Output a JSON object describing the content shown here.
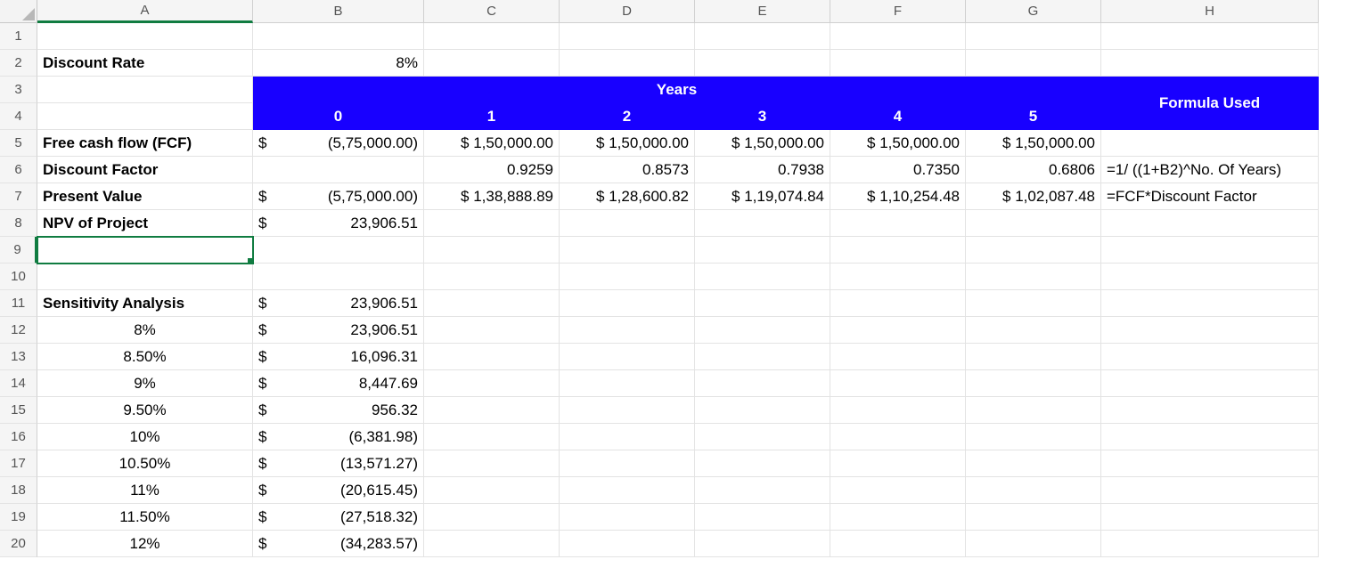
{
  "columns": [
    "A",
    "B",
    "C",
    "D",
    "E",
    "F",
    "G",
    "H"
  ],
  "row_numbers": [
    "1",
    "2",
    "3",
    "4",
    "5",
    "6",
    "7",
    "8",
    "9",
    "10",
    "11",
    "12",
    "13",
    "14",
    "15",
    "16",
    "17",
    "18",
    "19",
    "20"
  ],
  "active_col": "A",
  "active_row": "9",
  "labels": {
    "discount_rate": "Discount Rate",
    "years": "Years",
    "formula_used": "Formula Used",
    "fcf": "Free cash flow (FCF)",
    "discount_factor": "Discount Factor",
    "present_value": "Present Value",
    "npv": "NPV of Project",
    "sensitivity": "Sensitivity Analysis"
  },
  "discount_rate_value": "8%",
  "year_headers": [
    "0",
    "1",
    "2",
    "3",
    "4",
    "5"
  ],
  "fcf": {
    "y0": "(5,75,000.00)",
    "y1": "$ 1,50,000.00",
    "y2": "$ 1,50,000.00",
    "y3": "$ 1,50,000.00",
    "y4": "$ 1,50,000.00",
    "y5": "$ 1,50,000.00"
  },
  "discount_factor_vals": {
    "y1": "0.9259",
    "y2": "0.8573",
    "y3": "0.7938",
    "y4": "0.7350",
    "y5": "0.6806"
  },
  "pv": {
    "y0": "(5,75,000.00)",
    "y1": "$ 1,38,888.89",
    "y2": "$ 1,28,600.82",
    "y3": "$ 1,19,074.84",
    "y4": "$ 1,10,254.48",
    "y5": "$ 1,02,087.48"
  },
  "npv_value": "23,906.51",
  "formulas": {
    "df": "=1/ ((1+B2)^No. Of Years)",
    "pv": "=FCF*Discount Factor"
  },
  "sensitivity": {
    "header_val": "23,906.51",
    "rows": [
      {
        "rate": "8%",
        "val": "23,906.51"
      },
      {
        "rate": "8.50%",
        "val": "16,096.31"
      },
      {
        "rate": "9%",
        "val": "8,447.69"
      },
      {
        "rate": "9.50%",
        "val": "956.32"
      },
      {
        "rate": "10%",
        "val": "(6,381.98)"
      },
      {
        "rate": "10.50%",
        "val": "(13,571.27)"
      },
      {
        "rate": "11%",
        "val": "(20,615.45)"
      },
      {
        "rate": "11.50%",
        "val": "(27,518.32)"
      },
      {
        "rate": "12%",
        "val": "(34,283.57)"
      }
    ]
  },
  "currency_symbol": "$"
}
